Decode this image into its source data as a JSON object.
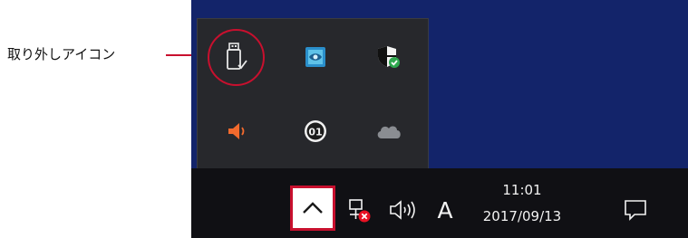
{
  "annotation": {
    "label": "取り外しアイコン",
    "highlight_color": "#c8102e"
  },
  "tray_overflow": {
    "icons": [
      {
        "name": "safely-remove-hardware-icon"
      },
      {
        "name": "app-network-icon"
      },
      {
        "name": "security-shield-icon"
      },
      {
        "name": "speaker-icon"
      },
      {
        "name": "o1-app-icon"
      },
      {
        "name": "cloud-icon"
      }
    ]
  },
  "taskbar": {
    "show_hidden_icons": {
      "icon": "chevron-up-icon"
    },
    "network": {
      "icon": "network-disconnected-icon"
    },
    "volume": {
      "icon": "volume-icon"
    },
    "ime_indicator": "A",
    "clock": {
      "time": "11:01",
      "date": "2017/09/13"
    },
    "action_center": {
      "icon": "action-center-icon"
    }
  },
  "colors": {
    "desktop": "#13246a",
    "flyout": "#27282c",
    "taskbar": "#101014",
    "accent": "#c8102e"
  }
}
